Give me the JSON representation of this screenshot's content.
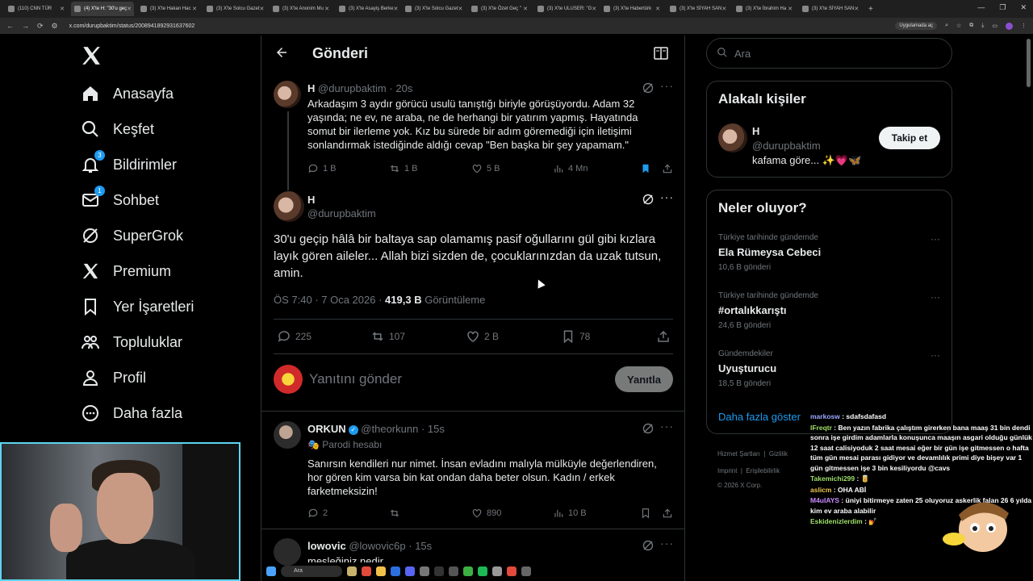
{
  "browser": {
    "tabs": [
      {
        "label": "(110) CNN TÜR"
      },
      {
        "label": "(4) X'te H: \"30'u geç",
        "active": true
      },
      {
        "label": "(3) X'te Hakan Hac"
      },
      {
        "label": "(3) X'te Solcu Gazet"
      },
      {
        "label": "(3) X'te Anonim Mu"
      },
      {
        "label": "(3) X'te Asayiş Berke"
      },
      {
        "label": "(3) X'te Solcu Gazet"
      },
      {
        "label": "(3) X'te Özet Geç \""
      },
      {
        "label": "(3) X'te ULUSER: \"G"
      },
      {
        "label": "(3) X'te Habertürk"
      },
      {
        "label": "(3) X'te SİYAH SAN"
      },
      {
        "label": "(3) X'te İbrahim Ha"
      },
      {
        "label": "(3) X'te SİYAH SAN"
      }
    ],
    "url": "x.com/durupbaktim/status/2008941892931637602",
    "open_in_app": "Uygulamada aç"
  },
  "nav": {
    "items": [
      {
        "label": "Anasayfa",
        "icon": "home-icon"
      },
      {
        "label": "Keşfet",
        "icon": "search-icon"
      },
      {
        "label": "Bildirimler",
        "icon": "bell-icon",
        "badge": "3"
      },
      {
        "label": "Sohbet",
        "icon": "mail-icon",
        "badge": "1"
      },
      {
        "label": "SuperGrok",
        "icon": "grok-icon"
      },
      {
        "label": "Premium",
        "icon": "x-icon"
      },
      {
        "label": "Yer İşaretleri",
        "icon": "bookmark-icon"
      },
      {
        "label": "Topluluklar",
        "icon": "communities-icon"
      },
      {
        "label": "Profil",
        "icon": "profile-icon"
      },
      {
        "label": "Daha fazla",
        "icon": "more-icon"
      }
    ]
  },
  "header": {
    "title": "Gönderi"
  },
  "parent_tweet": {
    "name": "H",
    "handle": "@durupbaktim",
    "time": "20s",
    "text": "Arkadaşım 3 aydır görücü usulü tanıştığı biriyle görüşüyordu. Adam 32 yaşında; ne ev, ne araba, ne de herhangi bir yatırım yapmış. Hayatında somut bir ilerleme yok. Kız bu sürede bir adım göremediği için iletişimi sonlandırmak istediğinde aldığı cevap \"Ben başka bir şey yapamam.\"",
    "replies": "1 B",
    "reposts": "1 B",
    "likes": "5 B",
    "views": "4 Mn"
  },
  "main_tweet": {
    "name": "H",
    "handle": "@durupbaktim",
    "text": "30'u geçip hâlâ bir baltaya sap olamamış pasif oğullarını gül gibi kızlara layık gören aileler... Allah bizi sizden de, çocuklarınızdan da uzak tutsun, amin.",
    "time": "ÖS 7:40",
    "date": "7 Oca 2026",
    "views": "419,3 B",
    "views_label": "Görüntüleme",
    "replies": "225",
    "reposts": "107",
    "likes": "2 B",
    "bookmarks": "78"
  },
  "reply_composer": {
    "placeholder": "Yanıtını gönder",
    "button": "Yanıtla"
  },
  "replies": [
    {
      "name": "ORKUN",
      "handle": "@theorkunn",
      "time": "15s",
      "tag": "Parodi hesabı",
      "text": "Sanırsın kendileri nur nimet. İnsan evladını malıyla mülküyle değerlendiren, hor gören kim varsa bin kat ondan daha beter olsun. Kadın / erkek farketmeksizin!",
      "replies": "2",
      "likes": "890",
      "views": "10 B"
    },
    {
      "name": "lowovic",
      "handle": "@lowovic6p",
      "time": "15s",
      "text": "mesleğiniz nedir"
    }
  ],
  "sidebar": {
    "search_placeholder": "Ara",
    "related": {
      "title": "Alakalı kişiler",
      "name": "H",
      "handle": "@durupbaktim",
      "bio": "kafama göre... ✨💗🦋",
      "follow": "Takip et"
    },
    "trends": {
      "title": "Neler oluyor?",
      "items": [
        {
          "context": "Türkiye tarihinde gündemde",
          "name": "Ela Rümeysa Cebeci",
          "count": "10,6 B gönderi"
        },
        {
          "context": "Türkiye tarihinde gündemde",
          "name": "#ortalıkkarıştı",
          "count": "24,6 B gönderi"
        },
        {
          "context": "Gündemdekiler",
          "name": "Uyuşturucu",
          "count": "18,5 B gönderi"
        }
      ],
      "show_more": "Daha fazla göster"
    },
    "footer": {
      "line1a": "Hizmet Şartları",
      "line1b": "Gizlilik",
      "line2a": "Imprint",
      "line2b": "Erişilebilirlik",
      "copyright": "© 2026 X Corp."
    }
  },
  "chat": [
    {
      "nick": "markosw",
      "color": "#9aa8ff",
      "text": "sdafsdafasd"
    },
    {
      "nick": "lFreqtr",
      "color": "#9fe06a",
      "text": "Ben yazın fabrika çalıştım girerken bana maaş 31 bin dendi sonra işe girdim adamlarla konuşunca maaşın asgari olduğu günlük 12 saat calisiyoduk 2 saat mesai eğer bir gün işe gitmessen o hafta tüm gün mesai parası gidiyor ve devamlılık primi diye bişey var 1 gün gitmessen işe 3 bin kesiliyordu @cavs"
    },
    {
      "nick": "Takemichi299",
      "color": "#9fe06a",
      "text": "🥫"
    },
    {
      "nick": "aslicm",
      "color": "#f0c84a",
      "text": "OHA ABİ"
    },
    {
      "nick": "M4uIAYS",
      "color": "#c88aff",
      "text": "üniyi bitirmeye zaten 25 oluyoruz askerlik falan 26 6 yılda kim ev araba alabilir"
    },
    {
      "nick": "Eskidenizlerdim",
      "color": "#9fe06a",
      "text": "💅"
    }
  ],
  "taskbar": {
    "search": "Ara"
  }
}
